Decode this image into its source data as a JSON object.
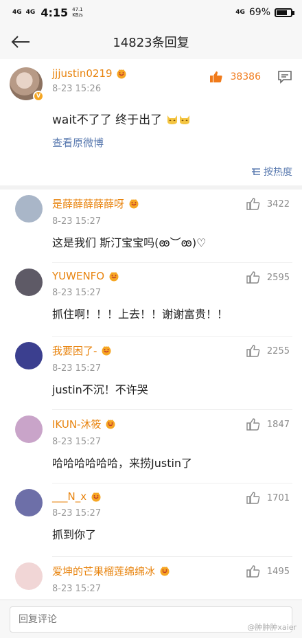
{
  "status_bar": {
    "network_1": "4G",
    "network_2": "4G",
    "time": "4:15",
    "speed_value": "47.1",
    "speed_unit": "KB/s",
    "network_right": "4G",
    "battery_percent": "69%",
    "battery_level": 0.69
  },
  "nav": {
    "title": "14823条回复"
  },
  "main_comment": {
    "username": "jjjustin0219",
    "time": "8-23 15:26",
    "like_count": "38386",
    "text": "wait不了了 终于出了",
    "view_original": "查看原微博"
  },
  "sort": {
    "label": "按热度"
  },
  "replies": [
    {
      "username": "是薛薛薛薛薛呀",
      "time": "8-23 15:27",
      "text": "这是我们 斯汀宝宝吗(ꙭ︶ꙭ)♡",
      "likes": "3422",
      "avatar_color": "#a9b6c8"
    },
    {
      "username": "YUWENFO",
      "time": "8-23 15:27",
      "text": "抓住啊！！！上去！！谢谢富贵！！",
      "likes": "2595",
      "avatar_color": "#5e5a66"
    },
    {
      "username": "我要困了-",
      "time": "8-23 15:27",
      "text": "justin不沉！不许哭",
      "likes": "2255",
      "avatar_color": "#3b3f8f"
    },
    {
      "username": "IKUN-沐筱",
      "time": "8-23 15:27",
      "text": "哈哈哈哈哈哈，来捞Justin了",
      "likes": "1847",
      "avatar_color": "#c9a4c9"
    },
    {
      "username": "___N_x",
      "time": "8-23 15:27",
      "text": "抓到你了",
      "likes": "1701",
      "avatar_color": "#6d6fa8"
    },
    {
      "username": "爱坤的芒果榴莲绵绵冰",
      "time": "8-23 15:27",
      "text": "",
      "likes": "1495",
      "avatar_color": "#f1d6d6"
    }
  ],
  "bottom": {
    "placeholder": "回复评论",
    "watermark": "@肿肿肿xaier"
  },
  "colors": {
    "username": "#e8840f",
    "link": "#5b7bb0",
    "like_active": "#f07a1a"
  }
}
